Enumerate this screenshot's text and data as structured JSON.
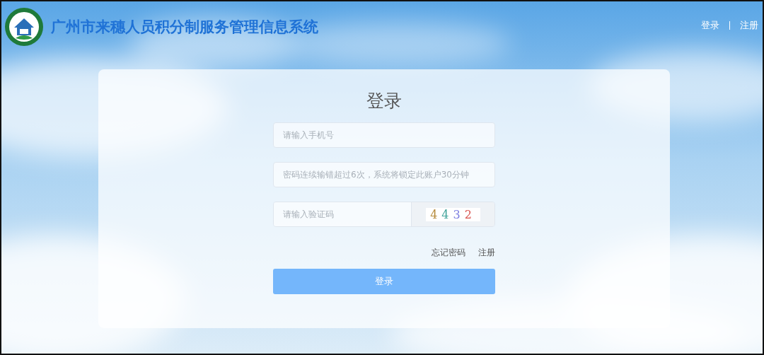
{
  "header": {
    "title": "广州市来穗人员积分制服务管理信息系统",
    "links": [
      {
        "label": "登录"
      },
      {
        "label": "注册"
      }
    ]
  },
  "login": {
    "title": "登录",
    "fields": [
      {
        "kind": "text",
        "placeholder": "请输入手机号"
      },
      {
        "kind": "password",
        "placeholder": "密码连续输错超过6次，系统将锁定此账户30分钟"
      },
      {
        "kind": "captcha",
        "placeholder": "请输入验证码",
        "captcha": "4432"
      }
    ],
    "links": [
      "忘记密码",
      "注册"
    ],
    "button": "登录"
  }
}
